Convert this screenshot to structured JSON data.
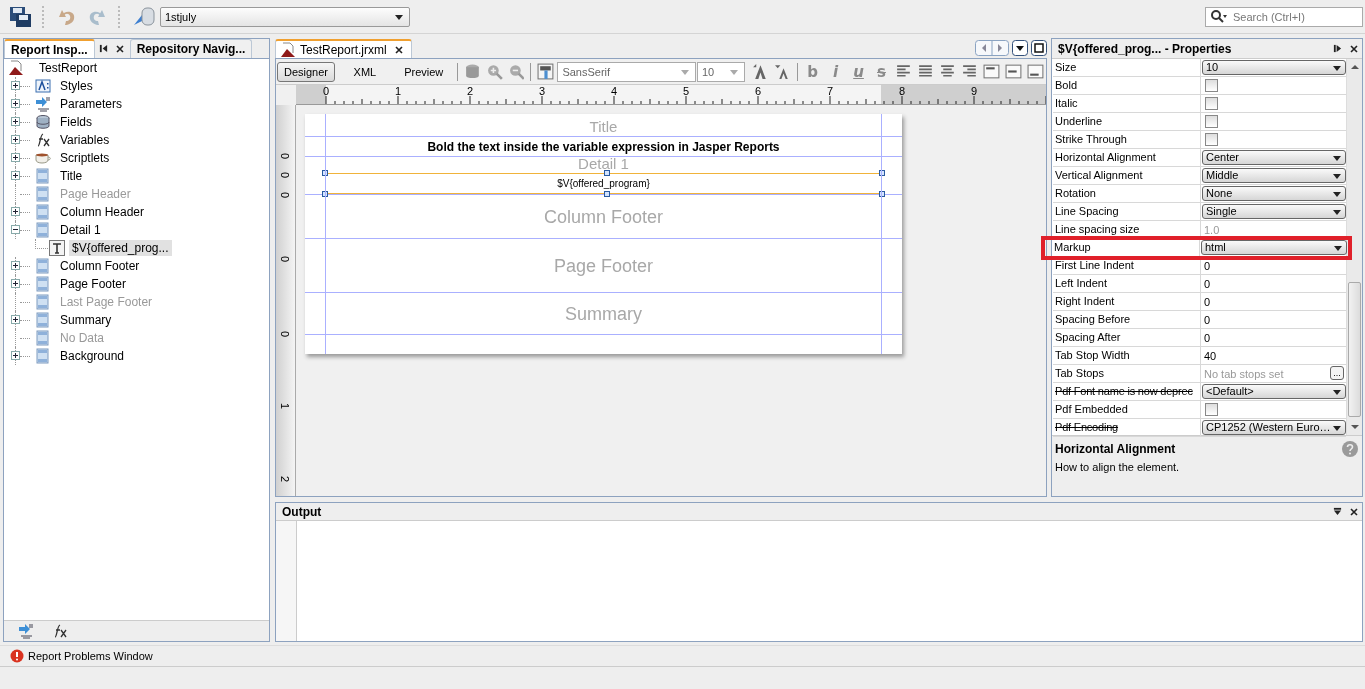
{
  "toolbar": {
    "datasource": "1stjuly",
    "search": {
      "placeholder": "Search (Ctrl+I)"
    }
  },
  "left_panel": {
    "tabs": [
      {
        "label": "Report Insp...",
        "selected": true
      },
      {
        "label": "Repository Navig...",
        "selected": false
      }
    ],
    "tree": {
      "label": "TestReport",
      "kind": "report",
      "children": [
        {
          "label": "Styles",
          "kind": "styles",
          "expanded": false,
          "disabled": false,
          "selected": false
        },
        {
          "label": "Parameters",
          "kind": "parameters",
          "expanded": false,
          "disabled": false,
          "selected": false
        },
        {
          "label": "Fields",
          "kind": "fields",
          "expanded": false,
          "disabled": false,
          "selected": false
        },
        {
          "label": "Variables",
          "kind": "variables",
          "expanded": false,
          "disabled": false,
          "selected": false
        },
        {
          "label": "Scriptlets",
          "kind": "scriptlets",
          "expanded": false,
          "disabled": false,
          "selected": false
        },
        {
          "label": "Title",
          "kind": "band",
          "expanded": false,
          "disabled": false,
          "selected": false
        },
        {
          "label": "Page Header",
          "kind": "band",
          "disabled": true,
          "selected": false
        },
        {
          "label": "Column Header",
          "kind": "band",
          "expanded": false,
          "disabled": false,
          "selected": false
        },
        {
          "label": "Detail 1",
          "kind": "band",
          "expanded": true,
          "disabled": false,
          "selected": false,
          "children": [
            {
              "label": "$V{offered_prog...",
              "kind": "textfield",
              "disabled": false,
              "selected": true
            }
          ]
        },
        {
          "label": "Column Footer",
          "kind": "band",
          "expanded": false,
          "disabled": false,
          "selected": false
        },
        {
          "label": "Page Footer",
          "kind": "band",
          "expanded": false,
          "disabled": false,
          "selected": false
        },
        {
          "label": "Last Page Footer",
          "kind": "band",
          "disabled": true,
          "selected": false
        },
        {
          "label": "Summary",
          "kind": "band",
          "expanded": false,
          "disabled": false,
          "selected": false
        },
        {
          "label": "No Data",
          "kind": "band",
          "disabled": true,
          "selected": false
        },
        {
          "label": "Background",
          "kind": "band",
          "expanded": false,
          "disabled": false,
          "selected": false
        }
      ]
    }
  },
  "editor": {
    "tab": "TestReport.jrxml",
    "views": [
      {
        "label": "Designer",
        "selected": true
      },
      {
        "label": "XML",
        "selected": false
      },
      {
        "label": "Preview",
        "selected": false
      }
    ],
    "font": "SansSerif",
    "font_size": "10",
    "format_buttons": [
      {
        "label": "b",
        "kind": "bold"
      },
      {
        "label": "i",
        "kind": "italic"
      },
      {
        "label": "u",
        "kind": "underline"
      },
      {
        "label": "s",
        "kind": "strike"
      }
    ],
    "ruler_labels": [
      "0",
      "1",
      "2",
      "3",
      "4",
      "5",
      "6",
      "7",
      "8",
      "9"
    ],
    "vertical_ruler_labels": [
      "0",
      "0",
      "0",
      "0",
      "0",
      "1",
      "2"
    ],
    "bands": [
      {
        "label": "Title",
        "element": {
          "text": "Bold the text inside the variable expression in Jasper Reports",
          "bold": true,
          "selected": false
        }
      },
      {
        "label": "Detail 1",
        "element": {
          "text": "$V{offered_program}",
          "bold": false,
          "selected": true
        }
      },
      {
        "label": "Column Footer"
      },
      {
        "label": "Page Footer"
      },
      {
        "label": "Summary"
      }
    ]
  },
  "properties": {
    "title": "$V{offered_prog... - Properties",
    "rows": [
      {
        "name": "Size",
        "kind": "dropdown",
        "value": "10",
        "deprecated": false,
        "highlighted": false
      },
      {
        "name": "Bold",
        "kind": "checkbox",
        "checked": false,
        "deprecated": false,
        "highlighted": false
      },
      {
        "name": "Italic",
        "kind": "checkbox",
        "checked": false,
        "deprecated": false,
        "highlighted": false
      },
      {
        "name": "Underline",
        "kind": "checkbox",
        "checked": false,
        "deprecated": false,
        "highlighted": false
      },
      {
        "name": "Strike Through",
        "kind": "checkbox",
        "checked": false,
        "deprecated": false,
        "highlighted": false
      },
      {
        "name": "Horizontal Alignment",
        "kind": "dropdown",
        "value": "Center",
        "deprecated": false,
        "highlighted": false
      },
      {
        "name": "Vertical Alignment",
        "kind": "dropdown",
        "value": "Middle",
        "deprecated": false,
        "highlighted": false
      },
      {
        "name": "Rotation",
        "kind": "dropdown",
        "value": "None",
        "deprecated": false,
        "highlighted": false
      },
      {
        "name": "Line Spacing",
        "kind": "dropdown",
        "value": "Single",
        "deprecated": false,
        "highlighted": false
      },
      {
        "name": "Line spacing size",
        "kind": "text",
        "value": "1.0",
        "disabled": true,
        "deprecated": false,
        "highlighted": false
      },
      {
        "name": "Markup",
        "kind": "dropdown",
        "value": "html",
        "deprecated": false,
        "highlighted": true
      },
      {
        "name": "First Line Indent",
        "kind": "text",
        "value": "0",
        "disabled": false,
        "deprecated": false,
        "highlighted": false
      },
      {
        "name": "Left Indent",
        "kind": "text",
        "value": "0",
        "disabled": false,
        "deprecated": false,
        "highlighted": false
      },
      {
        "name": "Right Indent",
        "kind": "text",
        "value": "0",
        "disabled": false,
        "deprecated": false,
        "highlighted": false
      },
      {
        "name": "Spacing Before",
        "kind": "text",
        "value": "0",
        "disabled": false,
        "deprecated": false,
        "highlighted": false
      },
      {
        "name": "Spacing After",
        "kind": "text",
        "value": "0",
        "disabled": false,
        "deprecated": false,
        "highlighted": false
      },
      {
        "name": "Tab Stop Width",
        "kind": "text",
        "value": "40",
        "disabled": false,
        "deprecated": false,
        "highlighted": false
      },
      {
        "name": "Tab Stops",
        "kind": "editor",
        "value": "No tab stops set",
        "button": "...",
        "disabled": true,
        "deprecated": false,
        "highlighted": false
      },
      {
        "name": "Pdf Font name is now deprec",
        "kind": "dropdown",
        "value": "<Default>",
        "deprecated": true,
        "highlighted": false
      },
      {
        "name": "Pdf Embedded",
        "kind": "checkbox",
        "checked": false,
        "deprecated": false,
        "highlighted": false
      },
      {
        "name": "Pdf Encoding",
        "kind": "dropdown",
        "value": "CP1252 (Western Euro…",
        "deprecated": true,
        "highlighted": false
      }
    ],
    "description": {
      "title": "Horizontal Alignment",
      "text": "How to align the element."
    }
  },
  "output": {
    "title": "Output"
  },
  "status_bar": {
    "text": "Report Problems Window"
  }
}
